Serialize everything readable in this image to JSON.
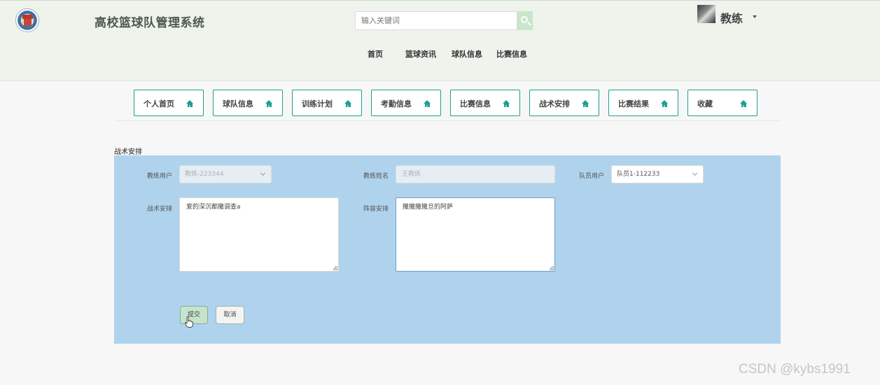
{
  "header": {
    "app_title": "高校篮球队管理系统",
    "search": {
      "placeholder": "输入关键词",
      "icon": "search-icon"
    },
    "user": {
      "name": "教练"
    },
    "nav": [
      "首页",
      "篮球资讯",
      "球队信息",
      "比赛信息"
    ]
  },
  "module_tabs": [
    "个人首页",
    "球队信息",
    "训练计划",
    "考勤信息",
    "比赛信息",
    "战术安排",
    "比赛结果",
    "收藏"
  ],
  "section": {
    "title": "战术安排"
  },
  "form": {
    "coach_user_label": "教练用户",
    "coach_user_value": "教练-223344",
    "coach_name_label": "教练姓名",
    "coach_name_value": "王教练",
    "player_user_label": "队员用户",
    "player_user_value": "队员1-112233",
    "tactics_label": "战术安排",
    "tactics_value": "爱的深沉都撒调查a",
    "lineup_label": "阵容安排",
    "lineup_value": "撒撒撒撒旦的阿萨",
    "submit_label": "提交",
    "cancel_label": "取消"
  },
  "colors": {
    "header_bg": "#eef3ec",
    "accent": "#1f9e8f",
    "panel_bg": "#afd3ec",
    "submit_bg": "#c6e3cd"
  },
  "watermark": "CSDN @kybs1991"
}
